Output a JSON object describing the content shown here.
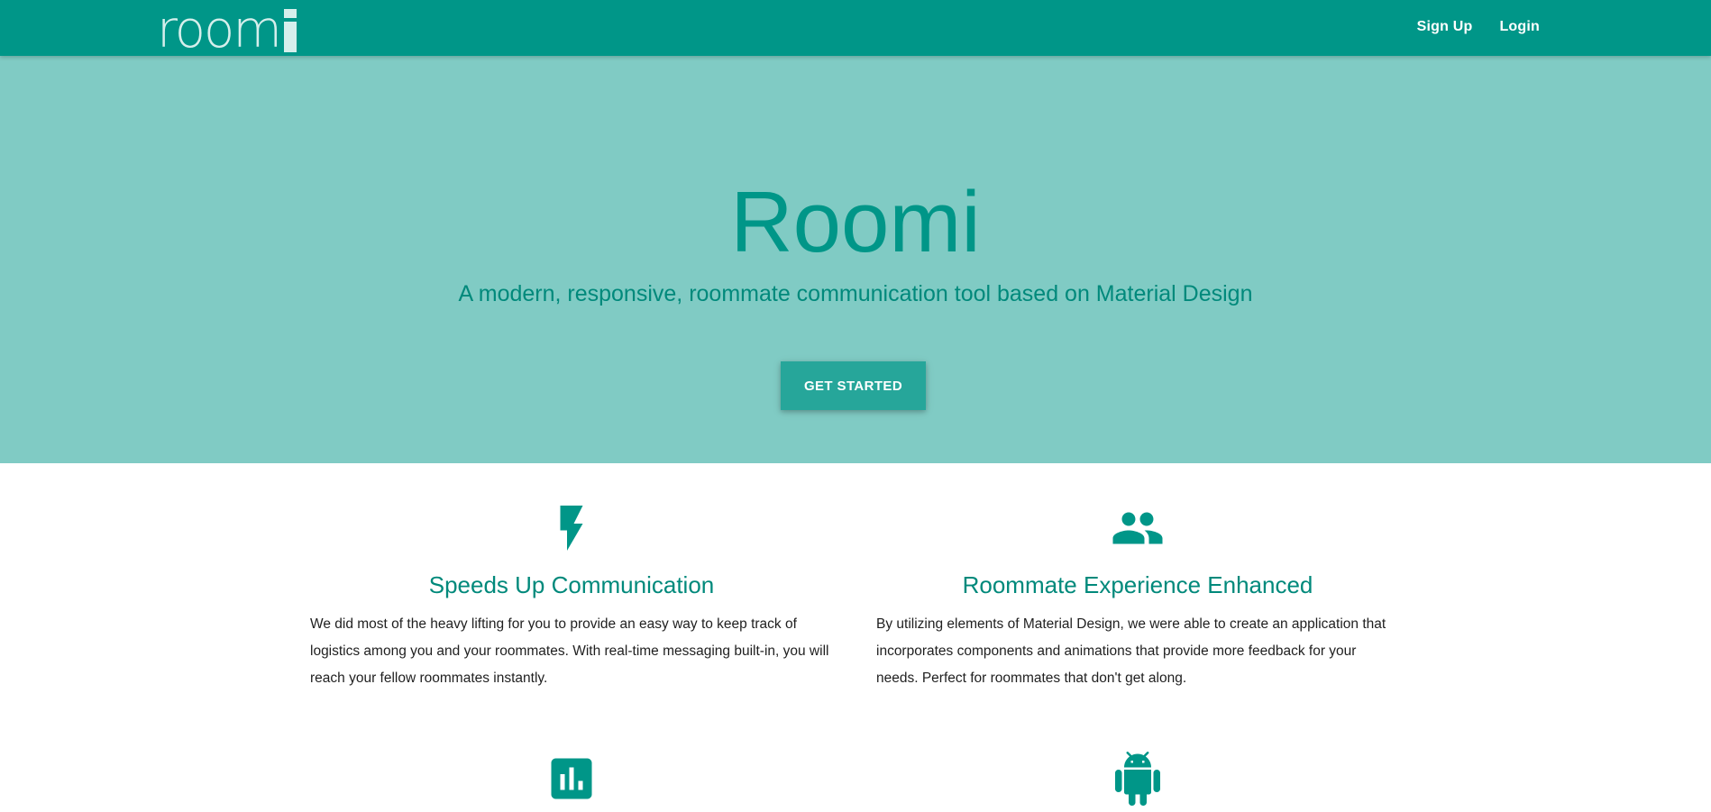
{
  "navbar": {
    "brand": "room",
    "links": [
      {
        "label": "Sign Up"
      },
      {
        "label": "Login"
      }
    ]
  },
  "hero": {
    "title": "Roomi",
    "subtitle": "A modern, responsive, roommate communication tool based on Material Design",
    "cta_label": "GET STARTED"
  },
  "features": [
    {
      "icon": "flash-icon",
      "title": "Speeds Up Communication",
      "text": "We did most of the heavy lifting for you to provide an easy way to keep track of logistics among you and your roommates. With real-time messaging built-in, you will reach your fellow roommates instantly."
    },
    {
      "icon": "group-icon",
      "title": "Roommate Experience Enhanced",
      "text": "By utilizing elements of Material Design, we were able to create an application that incorporates components and animations that provide more feedback for your needs. Perfect for roommates that don't get along."
    },
    {
      "icon": "bar-chart-icon"
    },
    {
      "icon": "android-icon"
    }
  ],
  "colors": {
    "primary": "#009688",
    "hero_bg": "#80cbc4",
    "button": "#26a69a",
    "heading": "#00897b"
  }
}
